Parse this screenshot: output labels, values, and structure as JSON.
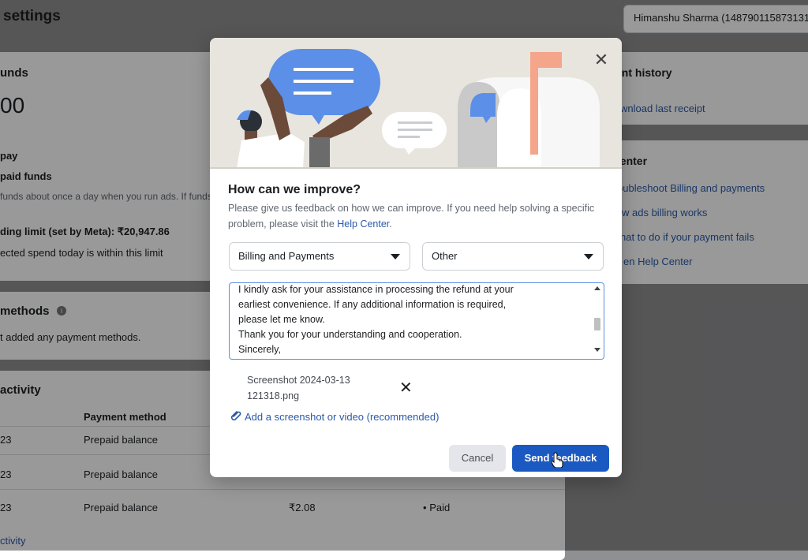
{
  "page": {
    "title": "settings",
    "account": "Himanshu Sharma (148790115873131"
  },
  "left_panel": {
    "funds_heading": "unds",
    "funds_amount": "00",
    "pay_label": "pay",
    "prepaid_label": "paid funds",
    "funds_note": "funds about once a day when you run ads. If funds r",
    "spending_limit": "ding limit (set by Meta): ₹20,947.86",
    "spend_note": "ected spend today is within this limit",
    "methods_heading": "methods",
    "methods_note": "t added any payment methods.",
    "activity_heading": "activity",
    "table": {
      "header_payment_method": "Payment method",
      "rows": [
        {
          "date": "23",
          "method": "Prepaid balance",
          "amount": "",
          "status": ""
        },
        {
          "date": "23",
          "method": "Prepaid balance",
          "amount": "",
          "status": ""
        },
        {
          "date": "23",
          "method": "Prepaid balance",
          "amount": "₹2.08",
          "status": "Paid"
        }
      ]
    },
    "view_activity": "ctivity"
  },
  "right_panel": {
    "history_heading": "ent history",
    "download_receipt": "wnload last receipt",
    "center_heading": "center",
    "links": [
      "oubleshoot Billing and payments",
      "w ads billing works",
      "hat to do if your payment fails",
      "en Help Center"
    ]
  },
  "modal": {
    "title": "How can we improve?",
    "desc_part1": "Please give us feedback on how we can improve. If you need help solving a specific problem, please visit the ",
    "help_link": "Help Center",
    "desc_end": ".",
    "category_select": "Billing and Payments",
    "subcategory_select": "Other",
    "feedback_lines": [
      "I kindly ask for your assistance in processing the refund at your",
      "earliest convenience. If any additional information is required,",
      "please let me know.",
      "Thank you for your understanding and cooperation.",
      "Sincerely,"
    ],
    "attachment_line1": "Screenshot 2024-03-13",
    "attachment_line2": "121318.png",
    "add_screenshot": "Add a screenshot or video (recommended)",
    "cancel": "Cancel",
    "send": "Send feedback"
  },
  "colors": {
    "primary": "#1b59c2",
    "link": "#2c5aa8",
    "overlay": "rgba(0,0,0,0.40)"
  }
}
